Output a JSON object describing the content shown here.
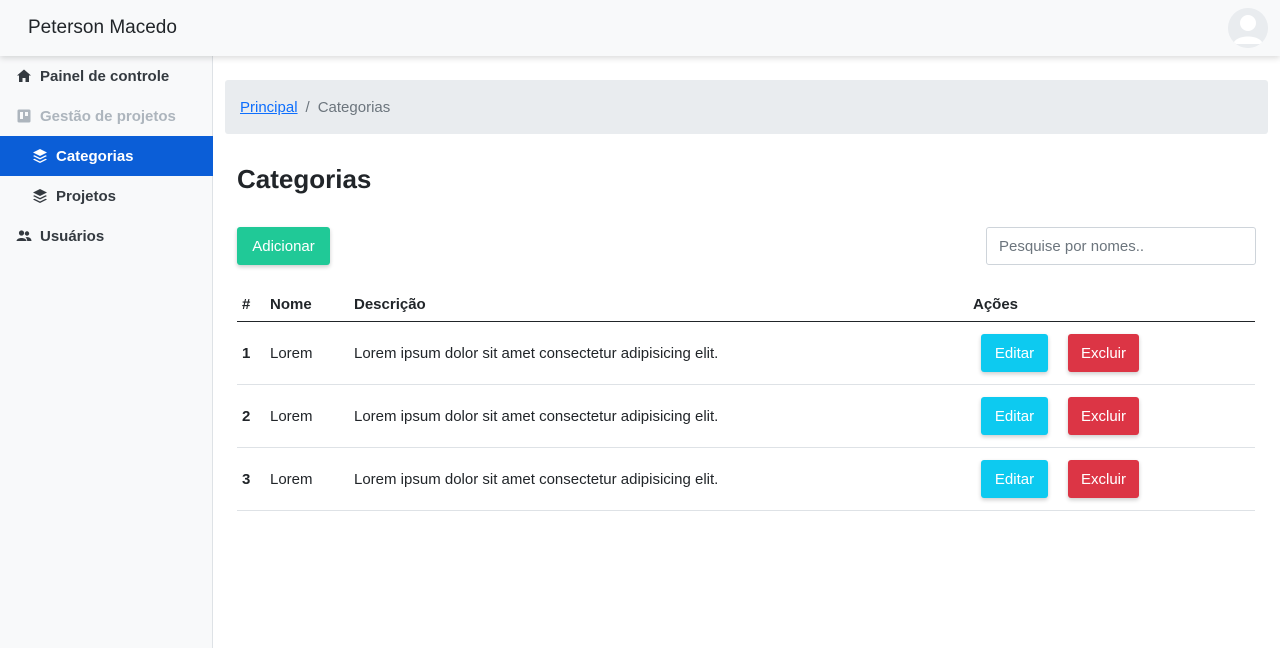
{
  "app": {
    "brand": "Peterson Macedo"
  },
  "sidebar": {
    "items": [
      {
        "label": "Painel de controle",
        "icon": "home-icon"
      },
      {
        "label": "Gestão de projetos",
        "icon": "project-board-icon"
      },
      {
        "label": "Categorias",
        "icon": "layers-icon",
        "active": true
      },
      {
        "label": "Projetos",
        "icon": "layers-icon"
      },
      {
        "label": "Usuários",
        "icon": "users-icon"
      }
    ]
  },
  "breadcrumb": {
    "home": "Principal",
    "current": "Categorias"
  },
  "page": {
    "title": "Categorias"
  },
  "toolbar": {
    "add_label": "Adicionar",
    "search_placeholder": "Pesquise por nomes.."
  },
  "table": {
    "headers": [
      "#",
      "Nome",
      "Descrição",
      "Ações"
    ],
    "rows": [
      {
        "id": "1",
        "name": "Lorem",
        "description": "Lorem ipsum dolor sit amet consectetur adipisicing elit.",
        "edit": "Editar",
        "delete": "Excluir"
      },
      {
        "id": "2",
        "name": "Lorem",
        "description": "Lorem ipsum dolor sit amet consectetur adipisicing elit.",
        "edit": "Editar",
        "delete": "Excluir"
      },
      {
        "id": "3",
        "name": "Lorem",
        "description": "Lorem ipsum dolor sit amet consectetur adipisicing elit.",
        "edit": "Editar",
        "delete": "Excluir"
      }
    ]
  },
  "colors": {
    "primary": "#0b5ed7",
    "add_button": "#20c997",
    "edit_button": "#0dcaf0",
    "delete_button": "#dc3545",
    "breadcrumb_bg": "#e9ecef"
  }
}
